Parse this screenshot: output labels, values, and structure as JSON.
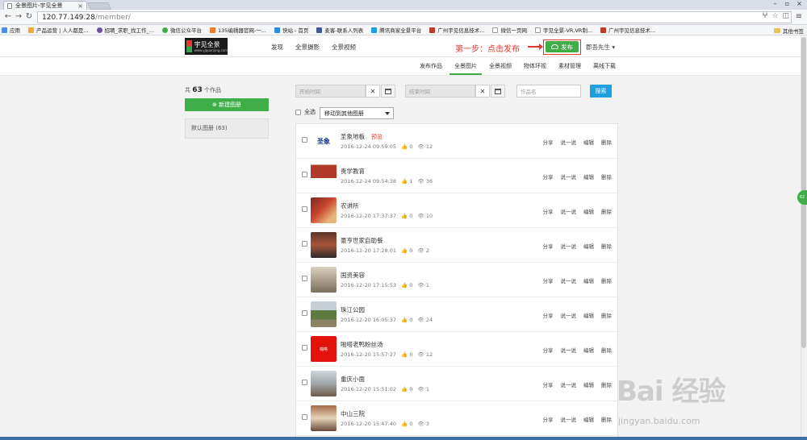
{
  "browser": {
    "tab_title": "全景图片-宇见全景",
    "url_host": "120.77.149.28",
    "url_path": "/member/",
    "bookmarks": [
      {
        "label": "应用",
        "color": "#4a8fe0"
      },
      {
        "label": "产品运营 | 人人都是...",
        "color": "#f2a93b"
      },
      {
        "label": "招聘_求职_找工作_...",
        "color": "#6b4fa8"
      },
      {
        "label": "微信公众平台",
        "color": "#3fae49"
      },
      {
        "label": "135编辑器官网-一...",
        "color": "#f07b2a"
      },
      {
        "label": "快站 - 首页",
        "color": "#2b8be3"
      },
      {
        "label": "麦客-联系人列表",
        "color": "#3b5998"
      },
      {
        "label": "腾讯商家全景平台",
        "color": "#1e9fe0"
      },
      {
        "label": "广州宇见信息技术...",
        "color": "#c0392b"
      },
      {
        "label": "微信一页网",
        "color": "#ffffff"
      },
      {
        "label": "宇见全景-VR,VR制...",
        "color": "#ffffff"
      },
      {
        "label": "广州宇见信息技术...",
        "color": "#c0392b"
      }
    ],
    "other_bookmarks": "其他书签"
  },
  "header": {
    "logo_text": "宇见全景",
    "logo_sub": "www.yjquanjing.com",
    "nav": [
      "发现",
      "全景摄影",
      "全景视频"
    ],
    "step_hint": "第一步：点击发布",
    "publish_label": "发布",
    "user_label": "郡吾先生 ▾"
  },
  "subnav": {
    "items": [
      "发布作品",
      "全景图片",
      "全景视频",
      "物体环视",
      "素材管理",
      "离线下载"
    ],
    "active_index": 1
  },
  "sidebar": {
    "count_prefix": "共",
    "count": "63",
    "count_suffix": "个作品",
    "new_album_label": "⊕ 新建图册",
    "default_album": "默认图册 (63)"
  },
  "filters": {
    "start_placeholder": "开始时间",
    "end_placeholder": "结束时间",
    "name_placeholder": "作品名",
    "search_label": "搜索",
    "select_all_label": "全选",
    "move_album_label": "移动到其他图册"
  },
  "actions": [
    "分享",
    "说一说",
    "编辑",
    "删除"
  ],
  "works": [
    {
      "title": "圣象地板",
      "tag": "预览",
      "time": "2016-12-24 09:59:05",
      "likes": "0",
      "views": "12",
      "thumb": "logo-shengxiang"
    },
    {
      "title": "贵学教育",
      "tag": "",
      "time": "2016-12-24 09:54:38",
      "likes": "1",
      "views": "36",
      "thumb": "logo-guixue"
    },
    {
      "title": "农讲所",
      "tag": "",
      "time": "2016-12-20 17:37:37",
      "likes": "0",
      "views": "10",
      "thumb": "photo-red"
    },
    {
      "title": "豪亨世家自助餐",
      "tag": "",
      "time": "2016-12-20 17:28:01",
      "likes": "0",
      "views": "2",
      "thumb": "photo-restaurant"
    },
    {
      "title": "国资美容",
      "tag": "",
      "time": "2016-12-20 17:15:53",
      "likes": "0",
      "views": "1",
      "thumb": "photo-corridor"
    },
    {
      "title": "珠江公园",
      "tag": "",
      "time": "2016-12-20 16:05:37",
      "likes": "0",
      "views": "24",
      "thumb": "photo-park"
    },
    {
      "title": "啪嗒老鸭粉丝汤",
      "tag": "",
      "time": "2016-12-20 15:57:27",
      "likes": "0",
      "views": "12",
      "thumb": "logo-red"
    },
    {
      "title": "重庆小面",
      "tag": "",
      "time": "2016-12-20 15:51:02",
      "likes": "0",
      "views": "1",
      "thumb": "photo-shop"
    },
    {
      "title": "中山三院",
      "tag": "",
      "time": "2016-12-20 15:47:40",
      "likes": "0",
      "views": "3",
      "thumb": "photo-hospital"
    }
  ],
  "watermark": {
    "main": "Bai 经验",
    "sub": "jingyan.baidu.com"
  },
  "colors": {
    "brand_green": "#3fae49",
    "hint_red": "#e03a2f",
    "search_blue": "#1e9fe0"
  }
}
